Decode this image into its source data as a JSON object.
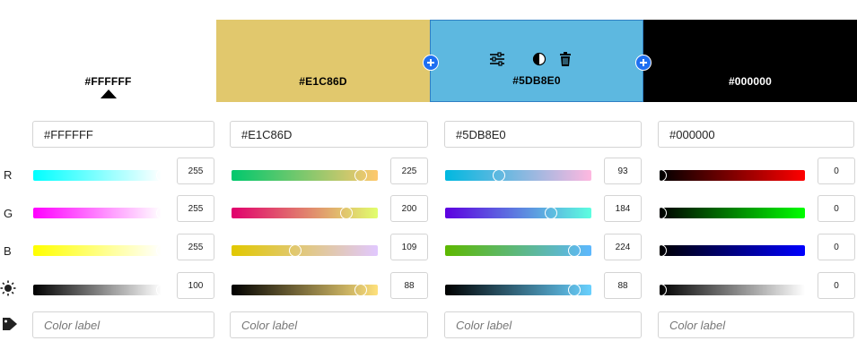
{
  "swatches": [
    {
      "hex": "#FFFFFF",
      "label": "#FFFFFF",
      "text_color": "#000000",
      "selected_indicator": true
    },
    {
      "hex": "#E1C86D",
      "label": "#E1C86D",
      "text_color": "#000000"
    },
    {
      "hex": "#5DB8E0",
      "label": "#5DB8E0",
      "text_color": "#000000",
      "selected": true
    },
    {
      "hex": "#000000",
      "label": "#000000",
      "text_color": "#ffffff"
    }
  ],
  "toolbar_icons": [
    "sliders-icon",
    "contrast-icon",
    "trash-icon"
  ],
  "add_buttons": [
    "add-swatch-left",
    "add-swatch-right"
  ],
  "row_labels": {
    "r": "R",
    "g": "G",
    "b": "B",
    "brightness_icon": "sun-icon",
    "label_icon": "tag-icon"
  },
  "columns": [
    {
      "hex_input": "#FFFFFF",
      "r": "255",
      "g": "255",
      "b": "255",
      "brightness": "100",
      "color_label_placeholder": "Color label",
      "r_level": 1.0,
      "g_level": 1.0,
      "b_level": 1.0,
      "brightness_level": 1.0
    },
    {
      "hex_input": "#E1C86D",
      "r": "225",
      "g": "200",
      "b": "109",
      "brightness": "88",
      "color_label_placeholder": "Color label",
      "r_level": 0.88,
      "g_level": 0.78,
      "b_level": 0.43,
      "brightness_level": 0.88
    },
    {
      "hex_input": "#5DB8E0",
      "r": "93",
      "g": "184",
      "b": "224",
      "brightness": "88",
      "color_label_placeholder": "Color label",
      "r_level": 0.36,
      "g_level": 0.72,
      "b_level": 0.88,
      "brightness_level": 0.88
    },
    {
      "hex_input": "#000000",
      "r": "0",
      "g": "0",
      "b": "0",
      "brightness": "0",
      "color_label_placeholder": "Color label",
      "r_level": 0.0,
      "g_level": 0.0,
      "b_level": 0.0,
      "brightness_level": 0.0
    }
  ]
}
